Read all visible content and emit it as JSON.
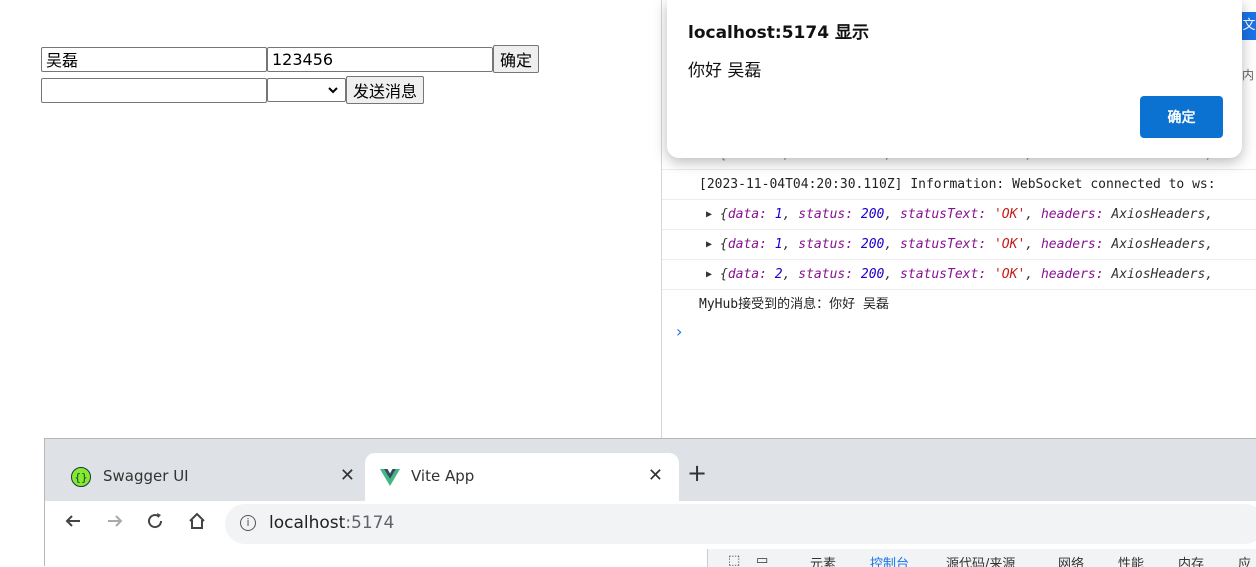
{
  "form": {
    "username_value": "吴磊",
    "password_value": "123456",
    "confirm_label": "确定",
    "message_value": "",
    "send_label": "发送消息"
  },
  "alert": {
    "title": "localhost:5174 显示",
    "message": "你好 吴磊",
    "ok_label": "确定"
  },
  "devtools": {
    "top_right_partial": "文",
    "side_partial": "内",
    "console_lines": [
      {
        "type": "log",
        "text": "[2023-11-04T04:20:30.110Z] Information: WebSocket connected to ws:"
      },
      {
        "type": "object",
        "data": "1",
        "status": "200",
        "statusText": "'OK'",
        "headers": "AxiosHeaders,"
      },
      {
        "type": "object",
        "data": "1",
        "status": "200",
        "statusText": "'OK'",
        "headers": "AxiosHeaders,"
      },
      {
        "type": "object",
        "data": "2",
        "status": "200",
        "statusText": "'OK'",
        "headers": "AxiosHeaders,"
      },
      {
        "type": "log",
        "text": "MyHub接受到的消息：你好 吴磊"
      }
    ],
    "prompt_symbol": "›"
  },
  "browser": {
    "tabs": [
      {
        "label": "Swagger UI",
        "active": false
      },
      {
        "label": "Vite App",
        "active": true
      }
    ],
    "url_host": "localhost",
    "url_port": ":5174",
    "devtools_tabs": [
      "元素",
      "控制台",
      "源代码/来源",
      "网络",
      "性能",
      "内存",
      "应"
    ]
  },
  "colors": {
    "accent": "#0b72d1",
    "vite_green": "#41b883",
    "swagger_green": "#85ea2d"
  }
}
